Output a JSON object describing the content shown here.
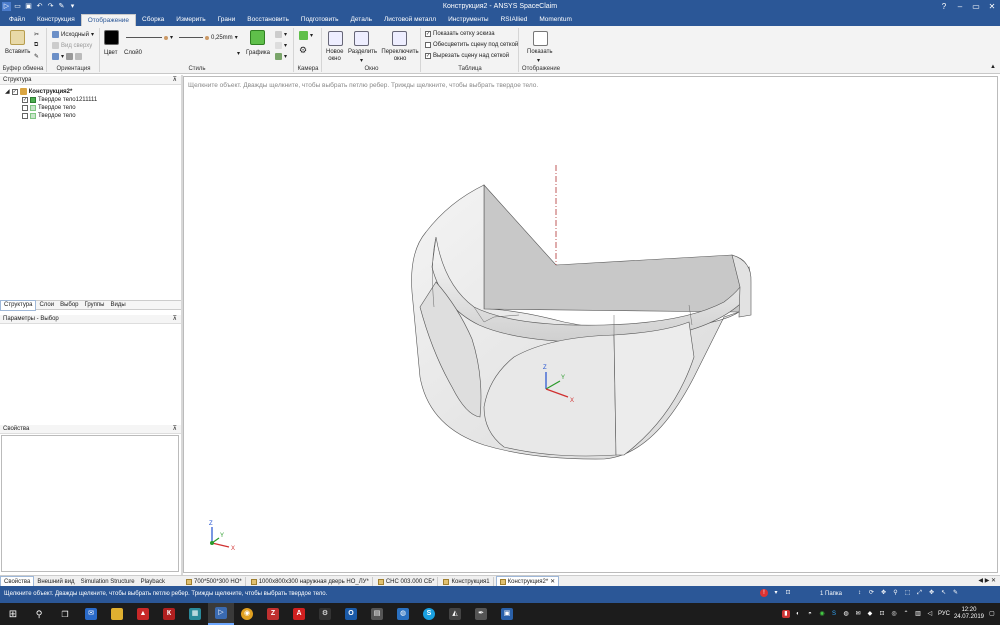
{
  "window": {
    "title": "Конструкция2 - ANSYS SpaceClaim",
    "quick_access": [
      "menu-icon",
      "open-icon",
      "save-icon",
      "undo-icon",
      "redo-icon",
      "pin-icon",
      "dropdown-icon"
    ]
  },
  "menu": {
    "tabs": [
      "Файл",
      "Конструкция",
      "Отображение",
      "Сборка",
      "Измерить",
      "Грани",
      "Восстановить",
      "Подготовить",
      "Деталь",
      "Листовой металл",
      "Инструменты",
      "RSIAllied",
      "Momentum"
    ],
    "active_index": 2
  },
  "ribbon": {
    "clipboard": {
      "label": "Буфер обмена",
      "paste": "Вставить"
    },
    "orientation": {
      "label": "Ориентация",
      "home": "Исходный",
      "top_view": "Вид сверху"
    },
    "style": {
      "label": "Стиль",
      "color": "Цвет",
      "layer": "Слой0",
      "line_width": "0,25mm",
      "graphics": "Графика",
      "swatch_color": "#000000"
    },
    "camera": {
      "label": "Камера"
    },
    "window": {
      "label": "Окно",
      "new_window": "Новое окно",
      "split": "Разделить",
      "switch_window": "Переключить окно"
    },
    "grid": {
      "label": "Таблица",
      "show_sketch_grid": "Показать сетку эскиза",
      "fade_scene_under_grid": "Обесцветить сцену под сеткой",
      "cut_scene_above_grid": "Вырезать сцену над сеткой",
      "checks": [
        true,
        false,
        true
      ]
    },
    "display": {
      "label": "Отображение",
      "show": "Показать"
    }
  },
  "structure": {
    "header": "Структура",
    "root": "Конструкция2*",
    "items": [
      "Твердое тело1211111",
      "Твердое тело",
      "Твердое тело"
    ],
    "item_checks": [
      true,
      false,
      false
    ],
    "tabs": [
      "Структура",
      "Слои",
      "Выбор",
      "Группы",
      "Виды"
    ]
  },
  "options": {
    "header": "Параметры - Выбор"
  },
  "properties": {
    "header": "Свойства"
  },
  "viewport": {
    "hint": "Щелкните объект. Дважды щелкните, чтобы выбрать петлю ребер. Трижды щелкните, чтобы выбрать твердое тело.",
    "axis_labels": {
      "x": "X",
      "y": "Y",
      "z": "Z"
    }
  },
  "bottom_tabs": [
    "Свойства",
    "Внешний вид",
    "Simulation Structure",
    "Playback"
  ],
  "doc_tabs": [
    {
      "label": "700*500*300 НО*",
      "active": false
    },
    {
      "label": "1000x800x300 наружная дверь НО_ЛУ*",
      "active": false
    },
    {
      "label": "СНС 003.000 СБ*",
      "active": false
    },
    {
      "label": "Конструкция1",
      "active": false
    },
    {
      "label": "Конструкция2*",
      "active": true
    }
  ],
  "status": {
    "message": "Щелкните объект. Дважды щелкните, чтобы выбрать петлю ребер. Трижды щелкните, чтобы выбрать твердое тело.",
    "folder_count": "1 Папка"
  },
  "taskbar": {
    "lang": "РУС",
    "time": "12:20",
    "date": "24.07.2019"
  }
}
